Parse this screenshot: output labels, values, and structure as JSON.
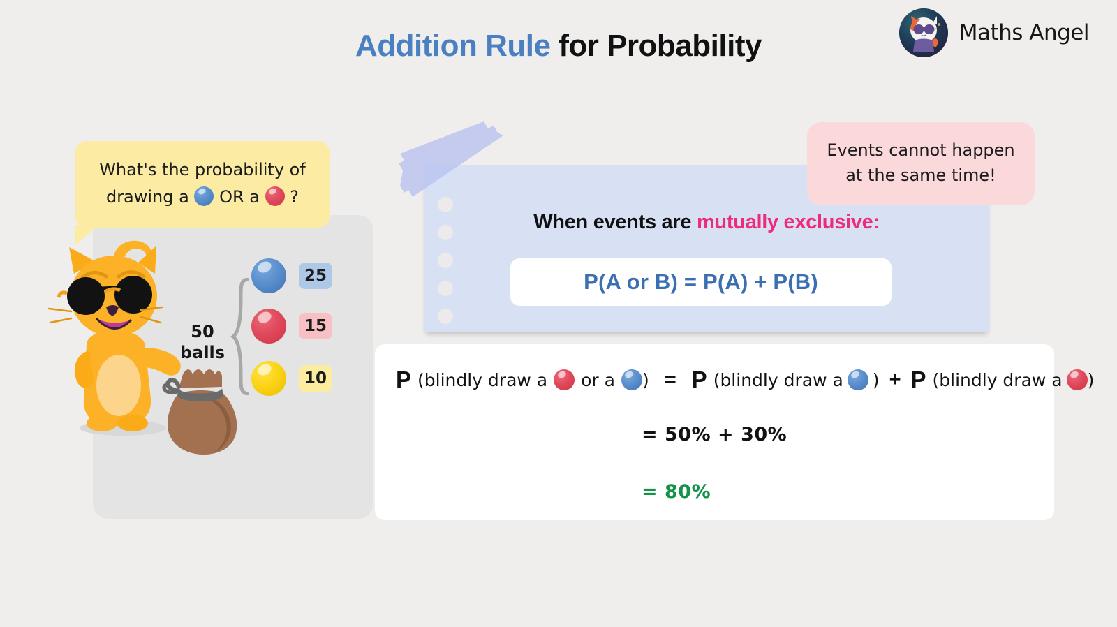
{
  "header": {
    "title_accent": "Addition Rule",
    "title_rest": " for Probability",
    "brand_name": "Maths Angel",
    "logo_icon": "cat-avatar-icon"
  },
  "question_bubble": {
    "line1": "What's the probability of",
    "line2_a": "drawing a",
    "line2_b": "OR a",
    "line2_c": "?",
    "ball_first": "blue",
    "ball_second": "red",
    "bg_color": "#fbeba3"
  },
  "bag_panel": {
    "total_label_line1": "50",
    "total_label_line2": "balls",
    "balls": [
      {
        "color_name": "blue",
        "count": "25",
        "badge_color": "#aec8e8"
      },
      {
        "color_name": "red",
        "count": "15",
        "badge_color": "#f8c0c5"
      },
      {
        "color_name": "yellow",
        "count": "10",
        "badge_color": "#fbeca0"
      }
    ],
    "mascot_icon": "cat-mascot-icon",
    "sack_icon": "ball-sack-icon",
    "brace_icon": "curly-brace-icon"
  },
  "note_card": {
    "heading_black": "When events are ",
    "heading_pink": "mutually exclusive:",
    "formula": "P(A or B)  =  P(A) + P(B)",
    "formula_color": "#3a6fb0",
    "accent_pink": "#ec2b7a",
    "bg_color": "#d8e1f4",
    "tape_icon": "washi-tape-icon",
    "hole_count": 5
  },
  "pink_callout": {
    "line1": "Events cannot happen",
    "line2": "at the same time!",
    "bg_color": "#fbd8da"
  },
  "working": {
    "line1": {
      "p1": "P",
      "t1": "(blindly draw a",
      "ball1": "red",
      "t2": "or a",
      "ball2": "blue",
      "t3": ")",
      "eq": "=",
      "p2": "P",
      "t4": "(blindly draw a",
      "ball3": "blue",
      "t5": ")",
      "plus": "+",
      "p3": "P",
      "t6": "(blindly draw a",
      "ball4": "red",
      "t7": ")"
    },
    "line2": "=   50%  +  30%",
    "line3": "=   80%",
    "result_color": "#14924a"
  }
}
